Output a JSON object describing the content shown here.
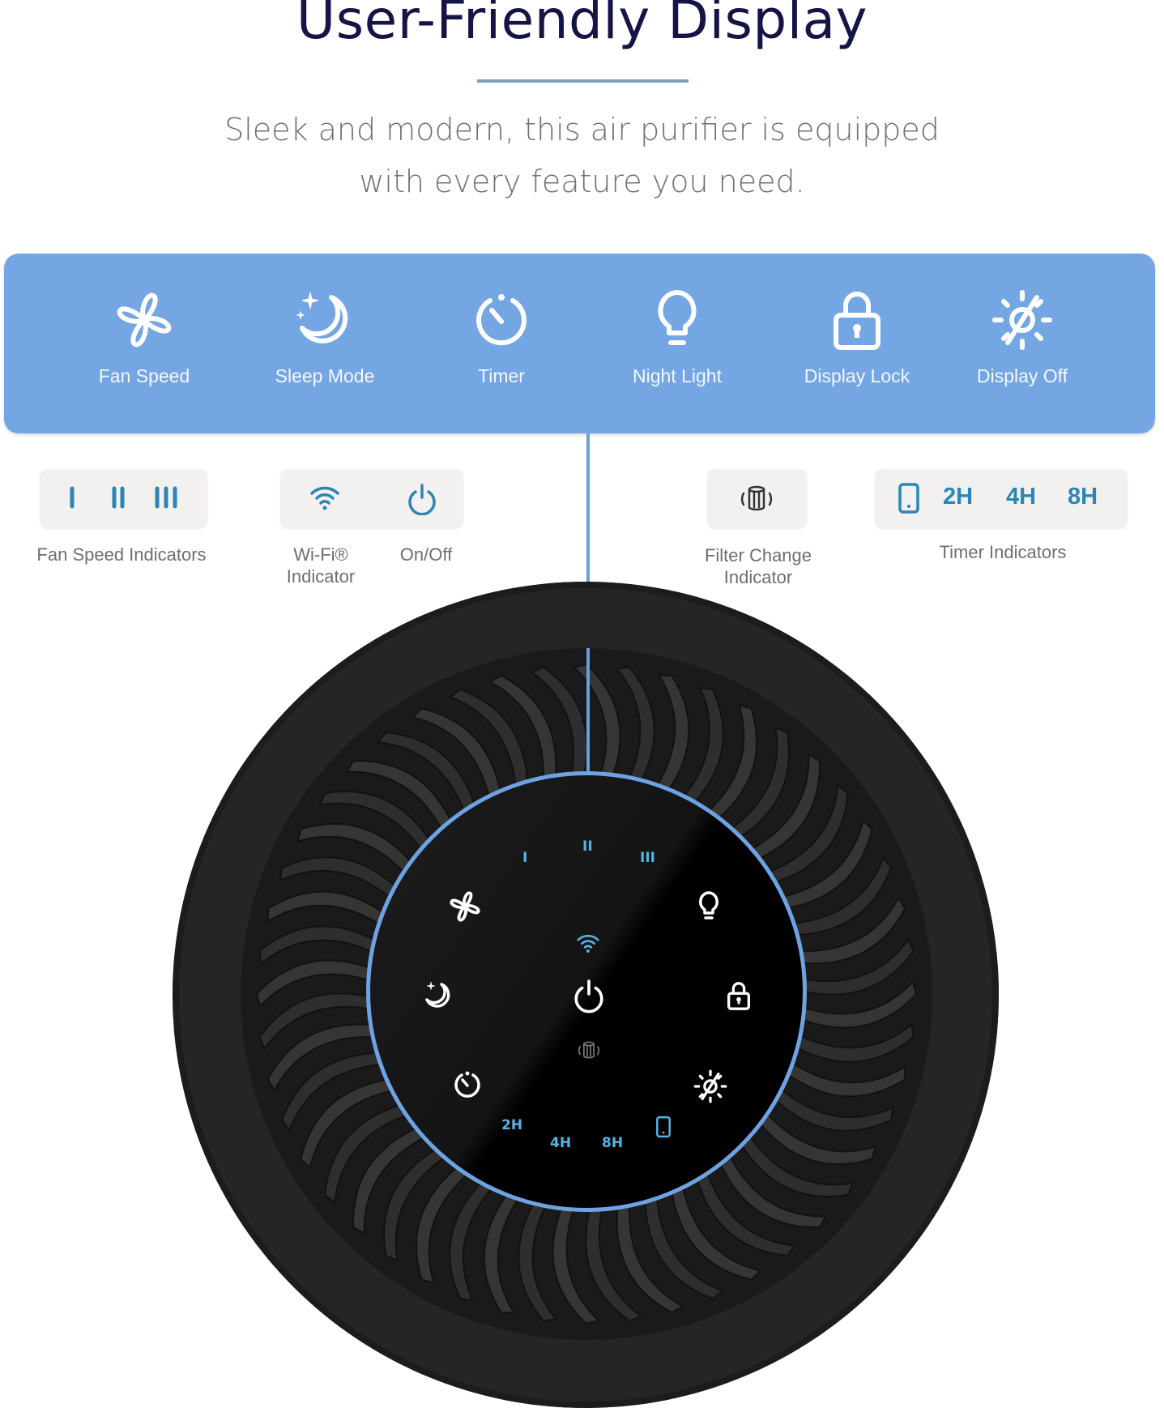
{
  "header": {
    "title": "User-Friendly Display",
    "subtitle_line1": "Sleek and modern, this air purifier is equipped",
    "subtitle_line2": "with every feature you need."
  },
  "colors": {
    "title": "#141447",
    "feature_bar": "#74a6e4",
    "indicator_blue": "#2b86b5",
    "panel_ring": "#6da3e3"
  },
  "features": [
    {
      "label": "Fan Speed",
      "icon": "fan-icon"
    },
    {
      "label": "Sleep Mode",
      "icon": "moon-stars-icon"
    },
    {
      "label": "Timer",
      "icon": "timer-icon"
    },
    {
      "label": "Night Light",
      "icon": "lightbulb-icon"
    },
    {
      "label": "Display Lock",
      "icon": "lock-icon"
    },
    {
      "label": "Display Off",
      "icon": "display-off-icon"
    }
  ],
  "indicators": {
    "fan_speed": {
      "label": "Fan Speed Indicators",
      "levels": [
        "I",
        "II",
        "III"
      ]
    },
    "wifi": {
      "label_line1": "Wi-Fi®",
      "label_line2": "Indicator"
    },
    "power": {
      "label": "On/Off"
    },
    "filter": {
      "label_line1": "Filter Change",
      "label_line2": "Indicator"
    },
    "timer": {
      "label": "Timer Indicators",
      "options": [
        "2H",
        "4H",
        "8H"
      ]
    }
  },
  "panel": {
    "speed_labels": [
      "I",
      "II",
      "III"
    ],
    "timer_labels": [
      "2H",
      "4H",
      "8H"
    ]
  }
}
